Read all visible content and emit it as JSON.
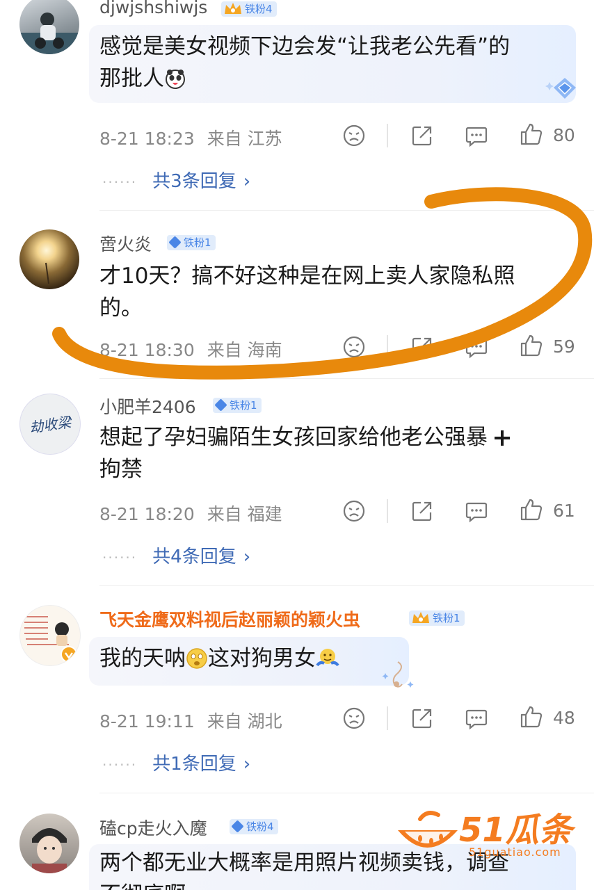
{
  "comments": [
    {
      "username": "djwjshshiwjs",
      "badge": "铁粉4",
      "badge_type": "crown",
      "text_lines": [
        "感觉是美女视频下边会发“让我老公先看”的",
        "那批人"
      ],
      "time": "8-21 18:23",
      "location": "来自 江苏",
      "likes": "80",
      "replies": "共3条回复"
    },
    {
      "username": "啻火炎",
      "badge": "铁粉1",
      "badge_type": "gem",
      "text_lines": [
        "才10天？搞不好这种是在网上卖人家隐私照",
        "的。"
      ],
      "time": "8-21 18:30",
      "location": "来自 海南",
      "likes": "59"
    },
    {
      "username": "小肥羊2406",
      "badge": "铁粉1",
      "badge_type": "gem",
      "avatar_text": "劫收梁",
      "text_lines": [
        "想起了孕妇骗陌生女孩回家给他老公强暴",
        "拘禁"
      ],
      "time": "8-21 18:20",
      "location": "来自 福建",
      "likes": "61",
      "replies": "共4条回复"
    },
    {
      "username": "飞天金鹰双料视后赵丽颖的颖火虫",
      "badge": "铁粉1",
      "badge_type": "crown",
      "text_parts": [
        "我的天呐",
        "这对狗男女"
      ],
      "time": "8-21 19:11",
      "location": "来自 湖北",
      "likes": "48",
      "replies": "共1条回复"
    },
    {
      "username": "磕cp走火入魔",
      "badge": "铁粉4",
      "badge_type": "gem",
      "text_lines": [
        "两个都无业大概率是用照片视频卖钱，调查",
        "不彻底啊"
      ]
    }
  ],
  "watermark": {
    "brand": "51瓜条",
    "url": "51guatiao.com"
  },
  "colors": {
    "username": "#555555",
    "vip_username": "#ef6b1a",
    "reply_link": "#3f6ab5",
    "annotation": "#e8890c",
    "badge_bg": "#e1ecfb"
  }
}
